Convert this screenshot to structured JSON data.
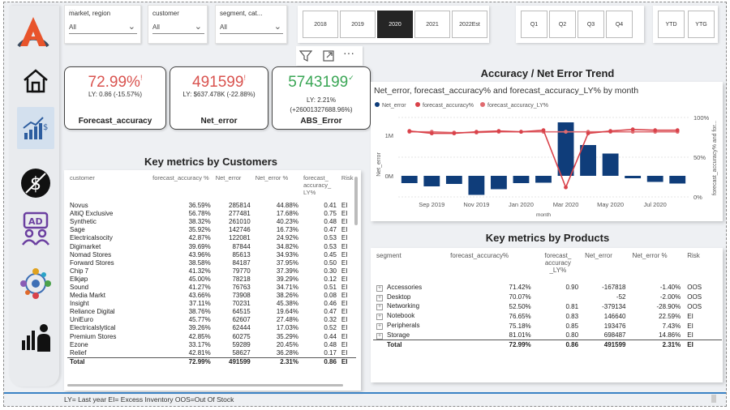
{
  "filters": {
    "market": {
      "title": "market, region",
      "value": "All"
    },
    "customer": {
      "title": "customer",
      "value": "All"
    },
    "segment": {
      "title": "segment, cat...",
      "value": "All"
    }
  },
  "years": [
    "2018",
    "2019",
    "2020",
    "2021",
    "2022Est"
  ],
  "selected_year": "2020",
  "quarters": [
    "Q1",
    "Q2",
    "Q3",
    "Q4"
  ],
  "period_buttons": [
    "YTD",
    "YTG"
  ],
  "kpis": [
    {
      "value": "72.99%",
      "flag": "!",
      "sub": "LY: 0.86 (-15.57%)",
      "label": "Forecast_accuracy",
      "color": "#d9534f"
    },
    {
      "value": "491599",
      "flag": "!",
      "sub": "LY: $637.478K (-22.88%)",
      "label": "Net_error",
      "color": "#d9534f"
    },
    {
      "value": "5743199",
      "flag": "✓",
      "sub": "LY: 2.21%",
      "sub2": "(+26001327688.96%)",
      "label": "ABS_Error",
      "color": "#3aa655"
    }
  ],
  "trend": {
    "heading": "Accuracy / Net Error Trend",
    "subtitle": "Net_error, forecast_accuracy% and forecast_accuracy_LY% by month",
    "legend": [
      "Net_error",
      "forecast_accuracy%",
      "forecast_accuracy_LY%"
    ],
    "ylabel_left": "Net_error",
    "ylabel_right": "forecast_accuracy% and for...",
    "xlabel": "month",
    "left_ticks": [
      "1M",
      "0M"
    ],
    "right_ticks": [
      "100%",
      "50%",
      "0%"
    ],
    "x_ticks": [
      "Sep 2019",
      "Nov 2019",
      "Jan 2020",
      "Mar 2020",
      "May 2020",
      "Jul 2020"
    ]
  },
  "chart_data": {
    "type": "bar",
    "categories": [
      "Aug 2019",
      "Sep 2019",
      "Oct 2019",
      "Nov 2019",
      "Dec 2019",
      "Jan 2020",
      "Feb 2020",
      "Mar 2020",
      "Apr 2020",
      "May 2020",
      "Jun 2020",
      "Jul 2020",
      "Aug 2020"
    ],
    "series": [
      {
        "name": "Net_error",
        "values": [
          -180000,
          -260000,
          -200000,
          -470000,
          -330000,
          -180000,
          -170000,
          1320000,
          760000,
          550000,
          -60000,
          -150000,
          -190000
        ]
      },
      {
        "name": "forecast_accuracy%",
        "values": [
          83,
          80,
          80,
          82,
          83,
          82,
          84,
          12,
          80,
          83,
          85,
          84,
          84
        ]
      },
      {
        "name": "forecast_accuracy_LY%",
        "values": [
          82,
          82,
          81,
          81,
          82,
          82,
          82,
          82,
          82,
          82,
          82,
          82,
          82
        ]
      }
    ],
    "colors": {
      "Net_error": "#0f3d7a",
      "forecast_accuracy%": "#d9424a",
      "forecast_accuracy_LY%": "#e06a6f"
    }
  },
  "customers": {
    "heading": "Key metrics by Customers",
    "headers": [
      "customer",
      "forecast_accuracy %",
      "Net_error",
      "Net_error %",
      "forecast_ accuracy_ LY%",
      "Risk"
    ],
    "rows": [
      [
        "Novus",
        "36.59%",
        "285814",
        "44.88%",
        "0.41",
        "EI"
      ],
      [
        "AltiQ Exclusive",
        "56.78%",
        "277481",
        "17.68%",
        "0.75",
        "EI"
      ],
      [
        "Synthetic",
        "38.32%",
        "261010",
        "40.23%",
        "0.48",
        "EI"
      ],
      [
        "Sage",
        "35.92%",
        "142746",
        "16.73%",
        "0.47",
        "EI"
      ],
      [
        "Electricalsocity",
        "42.87%",
        "122081",
        "24.92%",
        "0.53",
        "EI"
      ],
      [
        "Digimarket",
        "39.69%",
        "87844",
        "34.82%",
        "0.53",
        "EI"
      ],
      [
        "Nomad Stores",
        "43.96%",
        "85613",
        "34.93%",
        "0.45",
        "EI"
      ],
      [
        "Forward Stores",
        "38.58%",
        "84187",
        "37.95%",
        "0.50",
        "EI"
      ],
      [
        "Chip 7",
        "41.32%",
        "79770",
        "37.39%",
        "0.30",
        "EI"
      ],
      [
        "Elkjøp",
        "45.00%",
        "78218",
        "39.29%",
        "0.12",
        "EI"
      ],
      [
        "Sound",
        "41.27%",
        "76763",
        "34.71%",
        "0.51",
        "EI"
      ],
      [
        "Media Markt",
        "43.66%",
        "73908",
        "38.26%",
        "0.08",
        "EI"
      ],
      [
        "Insight",
        "37.11%",
        "70231",
        "45.38%",
        "0.46",
        "EI"
      ],
      [
        "Reliance Digital",
        "38.76%",
        "64515",
        "19.64%",
        "0.47",
        "EI"
      ],
      [
        "UniEuro",
        "45.77%",
        "62607",
        "27.48%",
        "0.32",
        "EI"
      ],
      [
        "Electricalslytical",
        "39.26%",
        "62444",
        "17.03%",
        "0.52",
        "EI"
      ],
      [
        "Premium Stores",
        "42.85%",
        "60275",
        "35.29%",
        "0.44",
        "EI"
      ],
      [
        "Ezone",
        "33.17%",
        "59289",
        "20.45%",
        "0.48",
        "EI"
      ],
      [
        "Relief",
        "42.81%",
        "58627",
        "36.28%",
        "0.17",
        "EI"
      ]
    ],
    "total": [
      "Total",
      "72.99%",
      "491599",
      "2.31%",
      "0.86",
      "EI"
    ]
  },
  "products": {
    "heading": "Key metrics by Products",
    "headers": [
      "segment",
      "forecast_accuracy%",
      "forecast_ accuracy _LY%",
      "Net_error",
      "Net_error %",
      "Risk"
    ],
    "rows": [
      [
        "Accessories",
        "71.42%",
        "0.90",
        "-167818",
        "-1.40%",
        "OOS"
      ],
      [
        "Desktop",
        "70.07%",
        "",
        "-52",
        "-2.00%",
        "OOS"
      ],
      [
        "Networking",
        "52.50%",
        "0.81",
        "-379134",
        "-28.90%",
        "OOS"
      ],
      [
        "Notebook",
        "76.65%",
        "0.83",
        "146640",
        "22.59%",
        "EI"
      ],
      [
        "Peripherals",
        "75.18%",
        "0.85",
        "193476",
        "7.43%",
        "EI"
      ],
      [
        "Storage",
        "81.01%",
        "0.80",
        "698487",
        "14.86%",
        "EI"
      ]
    ],
    "total": [
      "Total",
      "72.99%",
      "0.86",
      "491599",
      "2.31%",
      "EI"
    ]
  },
  "footer": "LY= Last year EI= Excess Inventory OOS=Out Of Stock",
  "nav": [
    "home-icon",
    "finance-growth-icon",
    "dollar-circle-icon",
    "ad-people-icon",
    "network-icon",
    "executive-icon"
  ]
}
